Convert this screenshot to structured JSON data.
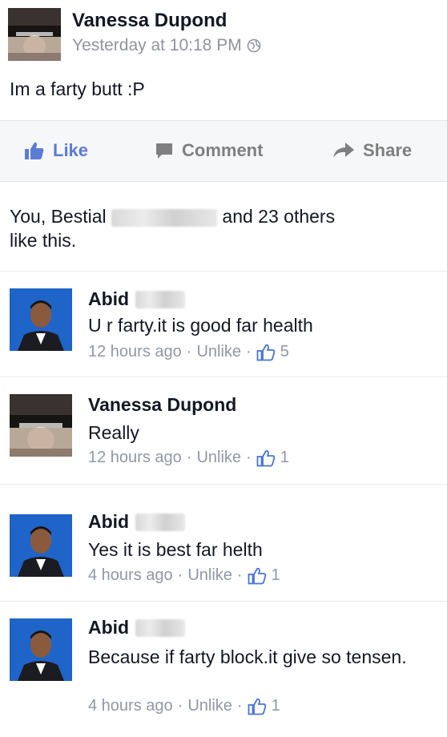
{
  "post": {
    "author": "Vanessa Dupond",
    "time": "Yesterday at 10:18 PM",
    "text": "Im a farty butt :P"
  },
  "actions": {
    "like": "Like",
    "comment": "Comment",
    "share": "Share"
  },
  "likes_summary": {
    "prefix": "You, Bestial",
    "suffix": "and 23 others",
    "line2": "like this."
  },
  "comments": [
    {
      "author": "Abid",
      "text": "U r farty.it is good far health",
      "time": "12 hours ago",
      "action": "Unlike",
      "likes": "5"
    },
    {
      "author": "Vanessa Dupond",
      "text": "Really",
      "time": "12 hours ago",
      "action": "Unlike",
      "likes": "1"
    },
    {
      "author": "Abid",
      "text": "Yes it is best far helth",
      "time": "4 hours ago",
      "action": "Unlike",
      "likes": "1"
    },
    {
      "author": "Abid",
      "text": "Because if farty block.it give so tensen.",
      "time": "4 hours ago",
      "action": "Unlike",
      "likes": "1"
    }
  ],
  "colors": {
    "like_blue": "#5b7bd5",
    "gray_text": "#90949c",
    "action_bg": "#f6f7f9"
  }
}
